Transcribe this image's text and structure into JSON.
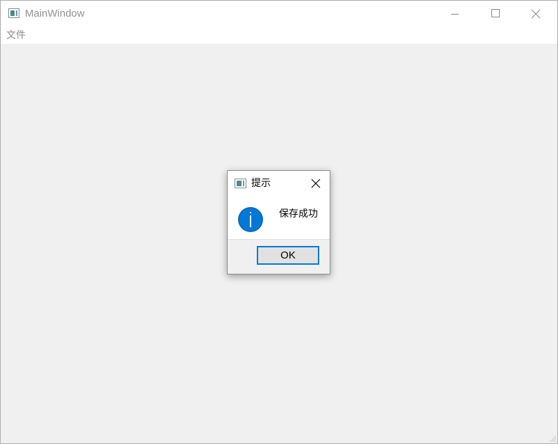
{
  "main_window": {
    "title": "MainWindow",
    "icon": "app-window-icon",
    "controls": [
      "minimize-icon",
      "maximize-icon",
      "close-icon"
    ]
  },
  "menubar": {
    "items": [
      {
        "label": "文件"
      }
    ]
  },
  "dialog": {
    "title": "提示",
    "icon": "info-icon",
    "message": "保存成功",
    "ok_label": "OK"
  },
  "colors": {
    "accent": "#0078d7",
    "window_bg": "#f0f0f0",
    "titlebar_bg": "#ffffff"
  }
}
